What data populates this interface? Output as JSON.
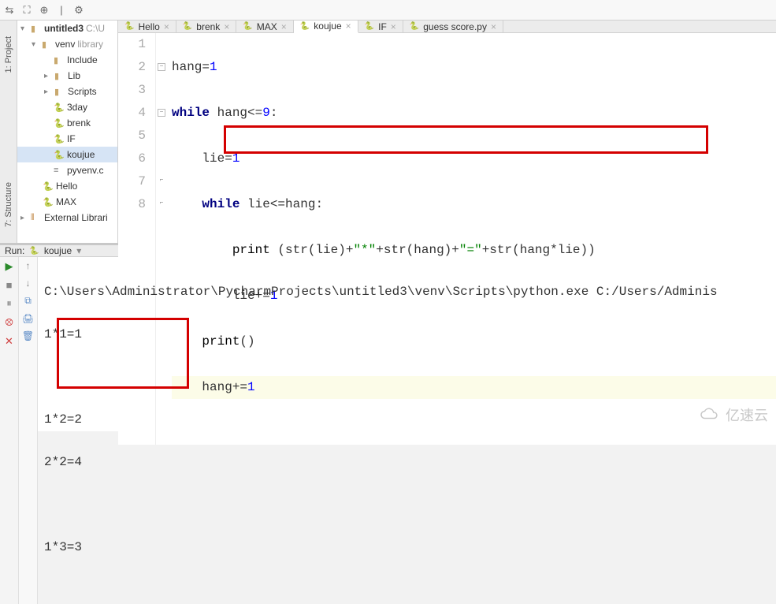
{
  "left_gutter": {
    "project_label": "1: Project",
    "structure_label": "7: Structure"
  },
  "project_tree": {
    "root": {
      "name": "untitled3",
      "suffix": "C:\\U"
    },
    "venv": {
      "name": "venv",
      "suffix": "library"
    },
    "include": "Include",
    "lib": "Lib",
    "scripts": "Scripts",
    "files": {
      "day3": "3day",
      "brenk": "brenk",
      "if": "IF",
      "koujue": "koujue",
      "pyvenv": "pyvenv.c",
      "hello": "Hello",
      "max": "MAX"
    },
    "external": "External Librari"
  },
  "tabs": [
    {
      "id": "hello",
      "label": "Hello"
    },
    {
      "id": "brenk",
      "label": "brenk"
    },
    {
      "id": "max",
      "label": "MAX"
    },
    {
      "id": "koujue",
      "label": "koujue",
      "active": true
    },
    {
      "id": "if",
      "label": "IF"
    },
    {
      "id": "guess",
      "label": "guess score.py"
    }
  ],
  "code": {
    "lines": [
      "1",
      "2",
      "3",
      "4",
      "5",
      "6",
      "7",
      "8"
    ],
    "l1_a": "hang",
    "l1_b": "=",
    "l1_c": "1",
    "l2_a": "while",
    "l2_b": " hang<=",
    "l2_c": "9",
    "l2_d": ":",
    "l3_a": "    lie=",
    "l3_b": "1",
    "l4_a": "    ",
    "l4_b": "while",
    "l4_c": " lie<=hang:",
    "l5_a": "        ",
    "l5_b": "print",
    "l5_c": " (str(lie)+",
    "l5_d": "\"*\"",
    "l5_e": "+str(hang)+",
    "l5_f": "\"=\"",
    "l5_g": "+str(hang*lie))",
    "l6_a": "        lie+=",
    "l6_b": "1",
    "l7_a": "    ",
    "l7_b": "print",
    "l7_c": "()",
    "l8_a": "    hang+=",
    "l8_b": "1"
  },
  "run": {
    "header_label": "Run:",
    "target": "koujue",
    "cmd": "C:\\Users\\Administrator\\PycharmProjects\\untitled3\\venv\\Scripts\\python.exe C:/Users/Adminis",
    "out1": "1*1=1",
    "out2": "1*2=2",
    "out3": "2*2=4",
    "out4": "1*3=3"
  },
  "watermark": "亿速云"
}
